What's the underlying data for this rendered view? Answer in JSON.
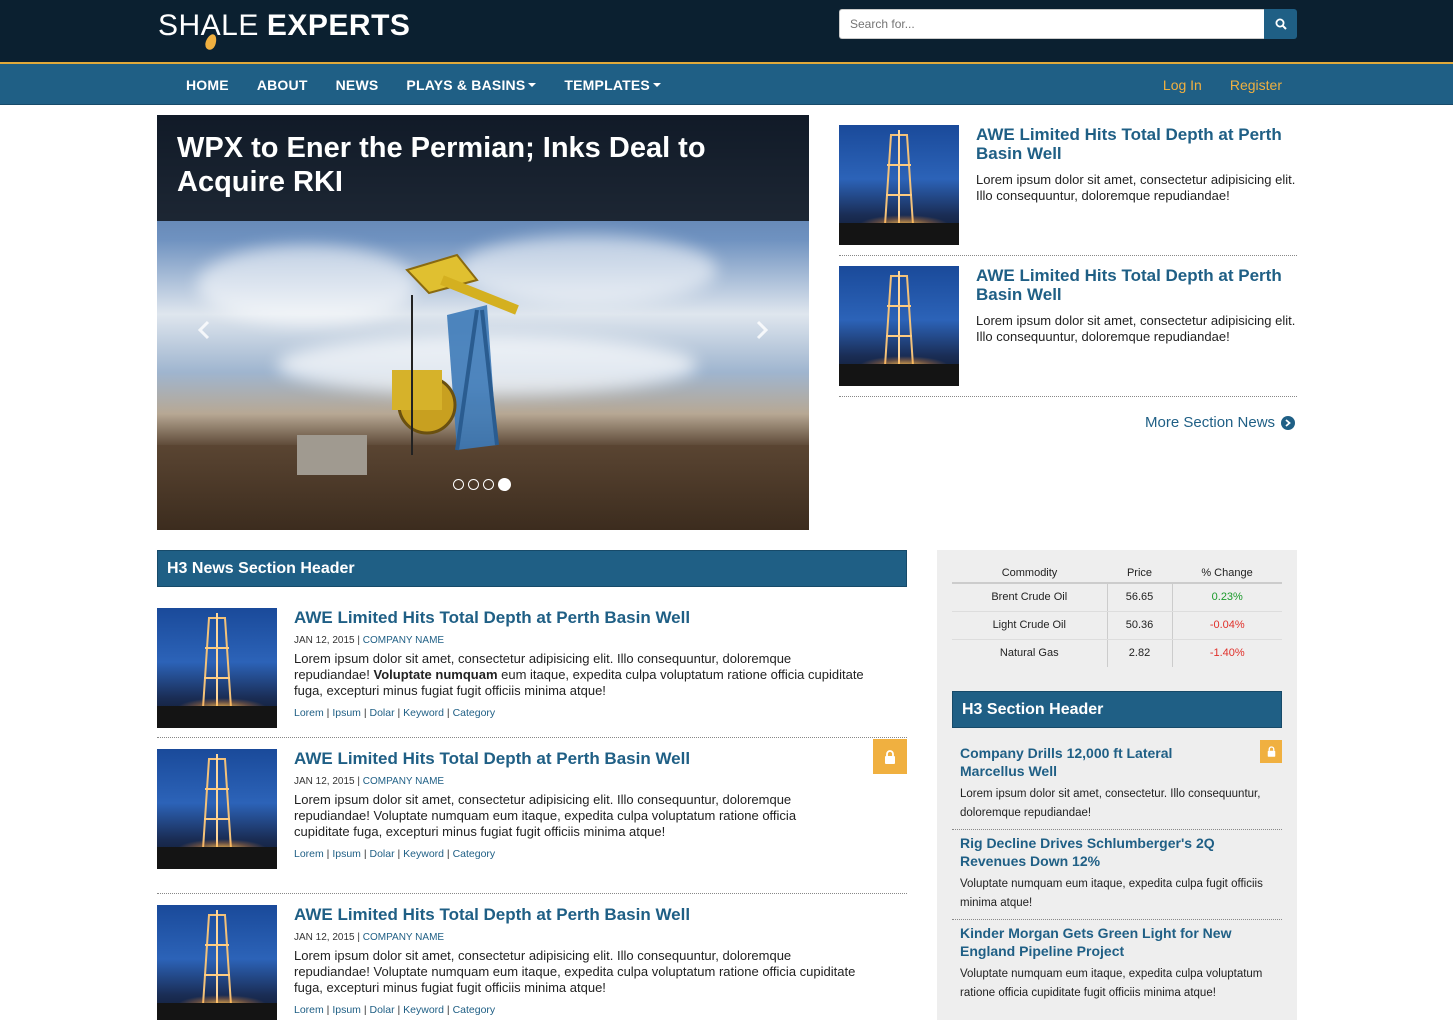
{
  "header": {
    "logo_part1": "SHALE",
    "logo_part2": "EXPERTS",
    "search_placeholder": "Search for..."
  },
  "nav": {
    "items": [
      "HOME",
      "ABOUT",
      "NEWS",
      "PLAYS & BASINS",
      "TEMPLATES"
    ],
    "login": "Log In",
    "register": "Register"
  },
  "carousel": {
    "title": "WPX to Ener the Permian; Inks Deal to Acquire RKI",
    "slide_count": 4,
    "active_slide": 4
  },
  "top_stories": [
    {
      "title": "AWE Limited Hits Total Depth at Perth Basin Well",
      "body": "Lorem ipsum dolor sit amet, consectetur adipisicing elit. Illo consequuntur, doloremque repudiandae!"
    },
    {
      "title": "AWE Limited Hits Total Depth at Perth Basin Well",
      "body": "Lorem ipsum dolor sit amet, consectetur adipisicing elit. Illo consequuntur, doloremque repudiandae!"
    }
  ],
  "more_news": "More Section News",
  "news_section": {
    "header": "H3 News Section Header",
    "items": [
      {
        "title": "AWE Limited Hits Total Depth at Perth Basin Well",
        "date": "JAN 12, 2015",
        "company": "COMPANY NAME",
        "body_a": "Lorem ipsum dolor sit amet, consectetur adipisicing elit. Illo consequuntur, doloremque repudiandae! ",
        "body_bold": "Voluptate numquam",
        "body_b": " eum itaque, expedita culpa voluptatum ratione officia cupiditate fuga, excepturi minus fugiat fugit officiis minima atque!",
        "locked": false
      },
      {
        "title": "AWE Limited Hits Total Depth at Perth Basin Well",
        "date": "JAN 12, 2015",
        "company": "COMPANY NAME",
        "body_a": "Lorem ipsum dolor sit amet, consectetur adipisicing elit. Illo consequuntur, doloremque repudiandae! Voluptate numquam eum itaque, expedita culpa voluptatum ratione officia cupiditate fuga, excepturi minus fugiat fugit officiis minima atque!",
        "body_bold": "",
        "body_b": "",
        "locked": true
      },
      {
        "title": "AWE Limited Hits Total Depth at Perth Basin Well",
        "date": "JAN 12, 2015",
        "company": "COMPANY NAME",
        "body_a": "Lorem ipsum dolor sit amet, consectetur adipisicing elit. Illo consequuntur, doloremque repudiandae! Voluptate numquam eum itaque, expedita culpa voluptatum ratione officia cupiditate fuga, excepturi minus fugiat fugit officiis minima atque!",
        "body_bold": "",
        "body_b": "",
        "locked": false
      }
    ],
    "tags": [
      "Lorem",
      "Ipsum",
      "Dolar",
      "Keyword",
      "Category"
    ]
  },
  "commodities": {
    "headers": [
      "Commodity",
      "Price",
      "% Change"
    ],
    "rows": [
      {
        "name": "Brent Crude Oil",
        "price": "56.65",
        "change": "0.23%",
        "dir": "up"
      },
      {
        "name": "Light Crude Oil",
        "price": "50.36",
        "change": "-0.04%",
        "dir": "down"
      },
      {
        "name": "Natural Gas",
        "price": "2.82",
        "change": "-1.40%",
        "dir": "down"
      }
    ]
  },
  "side_section": {
    "header": "H3 Section Header",
    "items": [
      {
        "title": "Company Drills 12,000 ft Lateral Marcellus Well",
        "body": "Lorem ipsum dolor sit amet, consectetur. Illo consequuntur, doloremque repudiandae!",
        "locked": true
      },
      {
        "title": "Rig Decline Drives Schlumberger's 2Q Revenues Down 12%",
        "body": "Voluptate numquam eum itaque, expedita culpa fugit officiis minima atque!",
        "locked": false
      },
      {
        "title": "Kinder Morgan Gets Green Light for New England Pipeline Project",
        "body": "Voluptate numquam eum itaque, expedita culpa voluptatum ratione officia cupiditate fugit officiis minima atque!",
        "locked": false
      }
    ]
  },
  "colors": {
    "brand_dark": "#0b2030",
    "brand_blue": "#1f5f85",
    "accent_gold": "#f0b040"
  }
}
